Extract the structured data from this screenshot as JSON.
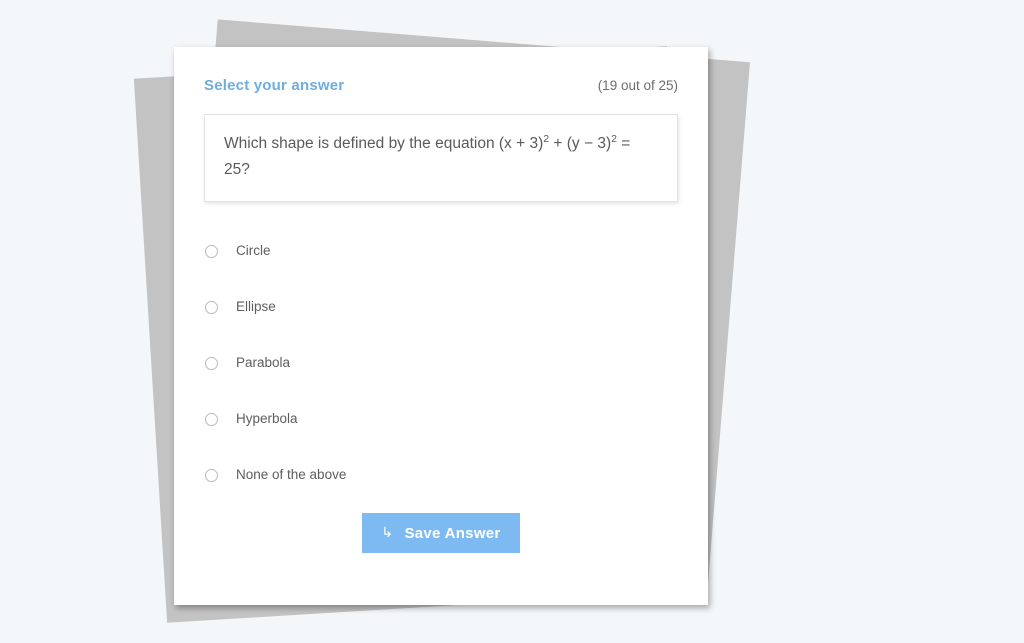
{
  "background": {
    "page_color": "#f4f7fa",
    "paper_stack_color": "#c3c3c3",
    "card_color": "#ffffff"
  },
  "header": {
    "title": "Select your answer",
    "title_color": "#6faddd",
    "counter": "(19 out of 25)",
    "counter_color": "#6d6d6d"
  },
  "question": {
    "prefix": "Which shape is defined by the equation (x + 3)",
    "exponent_1": "2",
    "middle": " + (y − 3)",
    "exponent_2": "2",
    "suffix": " = 25?",
    "full_text": "Which shape is defined by the equation (x + 3)2 + (y − 3)2 = 25?"
  },
  "options": [
    {
      "label": "Circle",
      "selected": false,
      "icon": "radio-unchecked-icon"
    },
    {
      "label": "Ellipse",
      "selected": false,
      "icon": "radio-unchecked-icon"
    },
    {
      "label": "Parabola",
      "selected": false,
      "icon": "radio-unchecked-icon"
    },
    {
      "label": "Hyperbola",
      "selected": false,
      "icon": "radio-unchecked-icon"
    },
    {
      "label": "None of the above",
      "selected": false,
      "icon": "radio-unchecked-icon"
    }
  ],
  "footer": {
    "save_label": "Save Answer",
    "save_icon": "↳",
    "save_icon_name": "enter-arrow-icon",
    "save_button_color": "#7dbaf2"
  }
}
